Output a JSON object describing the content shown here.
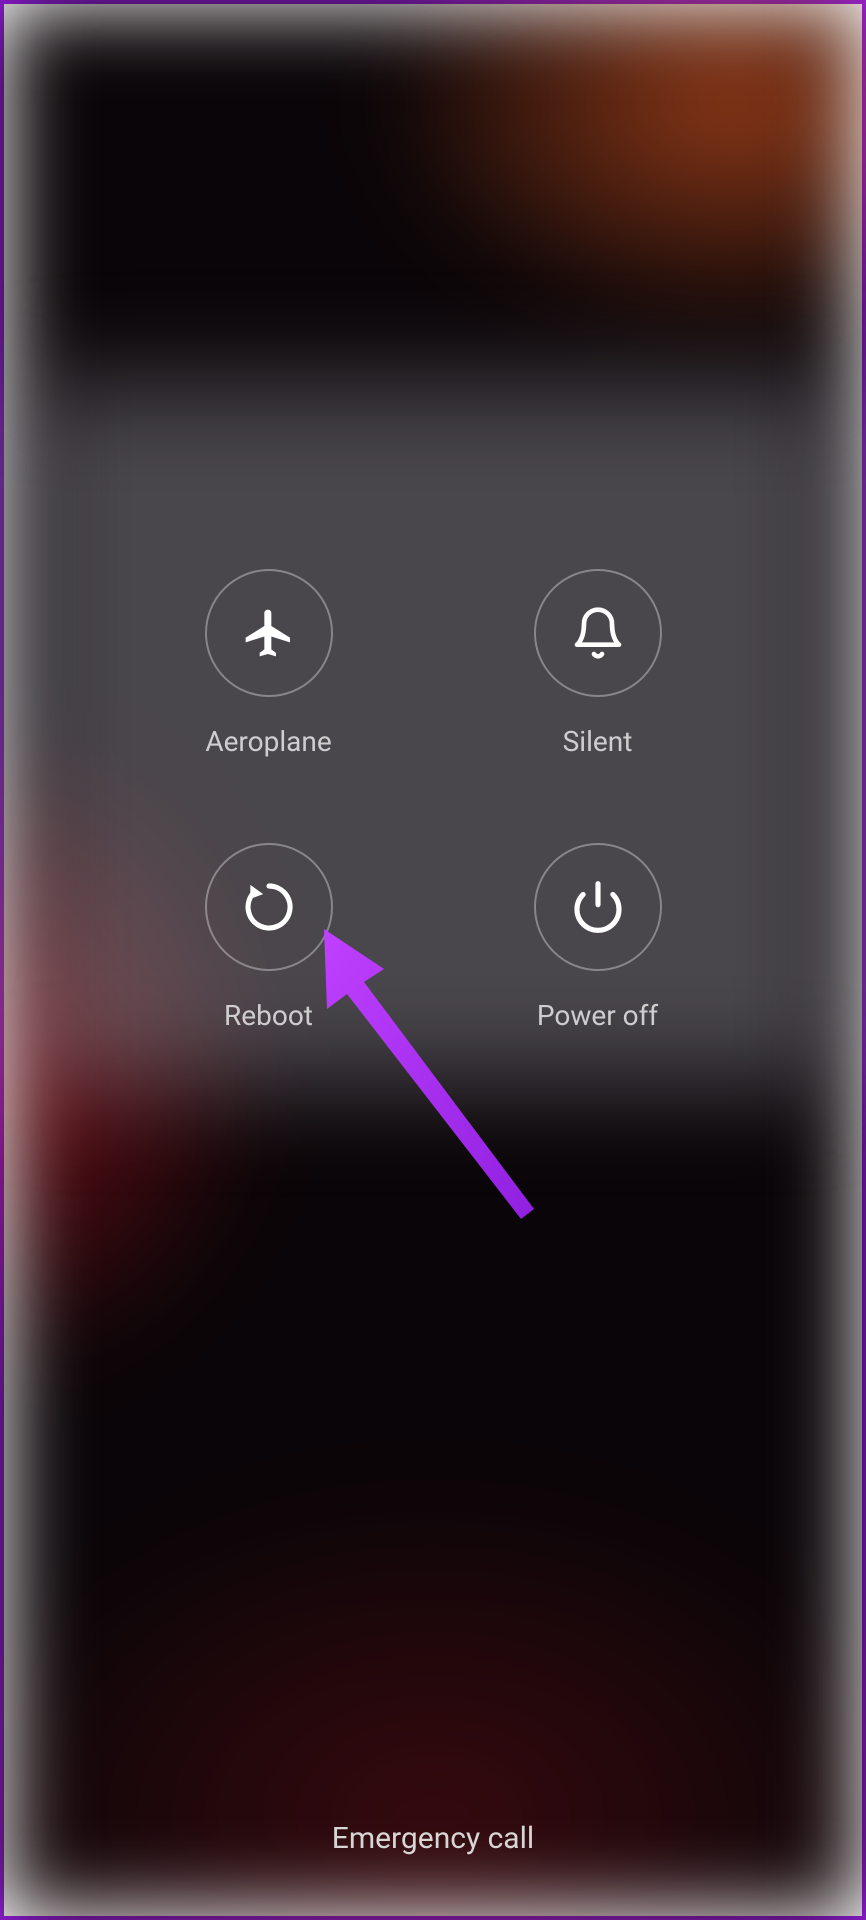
{
  "powerMenu": {
    "buttons": [
      {
        "id": "aeroplane",
        "label": "Aeroplane"
      },
      {
        "id": "silent",
        "label": "Silent"
      },
      {
        "id": "reboot",
        "label": "Reboot"
      },
      {
        "id": "poweroff",
        "label": "Power off"
      }
    ]
  },
  "emergencyCall": {
    "label": "Emergency call"
  },
  "annotation": {
    "color": "#b030f0"
  }
}
